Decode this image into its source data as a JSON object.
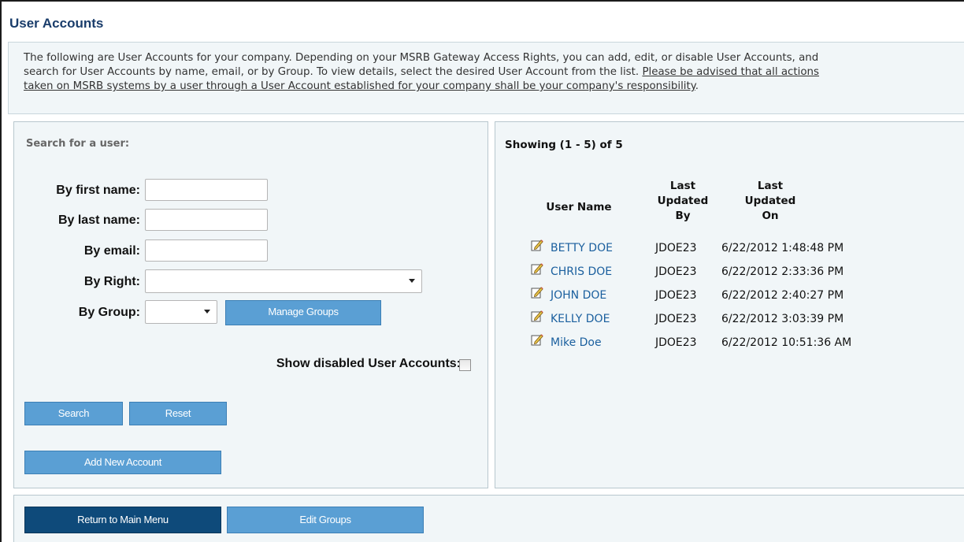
{
  "page": {
    "title": "User Accounts",
    "intro_lines": [
      "The following are User Accounts for your company. Depending on your MSRB Gateway Access Rights, you can add, edit, or disable User Accounts, and",
      "search for User Accounts by name, email, or by Group. To view details, select the desired User Account from the list."
    ],
    "intro_notice_part1": "Please be advised that all actions",
    "intro_notice_part2": "taken on MSRB systems by a user through a User Account established for your company shall be your company's responsibility",
    "intro_end": "."
  },
  "search": {
    "heading": "Search for a user:",
    "first_name_label": "By first name:",
    "first_name_value": "",
    "last_name_label": "By last name:",
    "last_name_value": "",
    "email_label": "By email:",
    "email_value": "",
    "right_label": "By Right:",
    "right_value": "",
    "group_label": "By Group:",
    "group_value": "",
    "manage_groups_button": "Manage Groups",
    "show_disabled_label": "Show disabled User Accounts:",
    "show_disabled_checked": false,
    "search_button": "Search",
    "reset_button": "Reset",
    "add_account_button": "Add New Account"
  },
  "results": {
    "count_text": "Showing (1 - 5) of 5",
    "headers": {
      "user_name": "User Name",
      "updated_by_1": "Last",
      "updated_by_2": "Updated",
      "updated_by_3": "By",
      "updated_on_1": "Last",
      "updated_on_2": "Updated",
      "updated_on_3": "On"
    },
    "rows": [
      {
        "user": "BETTY DOE",
        "by": "JDOE23",
        "on": "6/22/2012 1:48:48 PM"
      },
      {
        "user": "CHRIS DOE",
        "by": "JDOE23",
        "on": "6/22/2012 2:33:36 PM"
      },
      {
        "user": "JOHN DOE",
        "by": "JDOE23",
        "on": "6/22/2012 2:40:27 PM"
      },
      {
        "user": "KELLY DOE",
        "by": "JDOE23",
        "on": "6/22/2012 3:03:39 PM"
      },
      {
        "user": "Mike Doe",
        "by": "JDOE23",
        "on": "6/22/2012 10:51:36 AM"
      }
    ]
  },
  "footer": {
    "main_menu_button": "Return to Main Menu",
    "edit_groups_button": "Edit Groups"
  },
  "colors": {
    "title": "#1a3d6b",
    "button": "#5a9fd4",
    "button_dark": "#0e4a7a",
    "link": "#1a5f9e",
    "panel_bg": "#f1f6f8"
  }
}
